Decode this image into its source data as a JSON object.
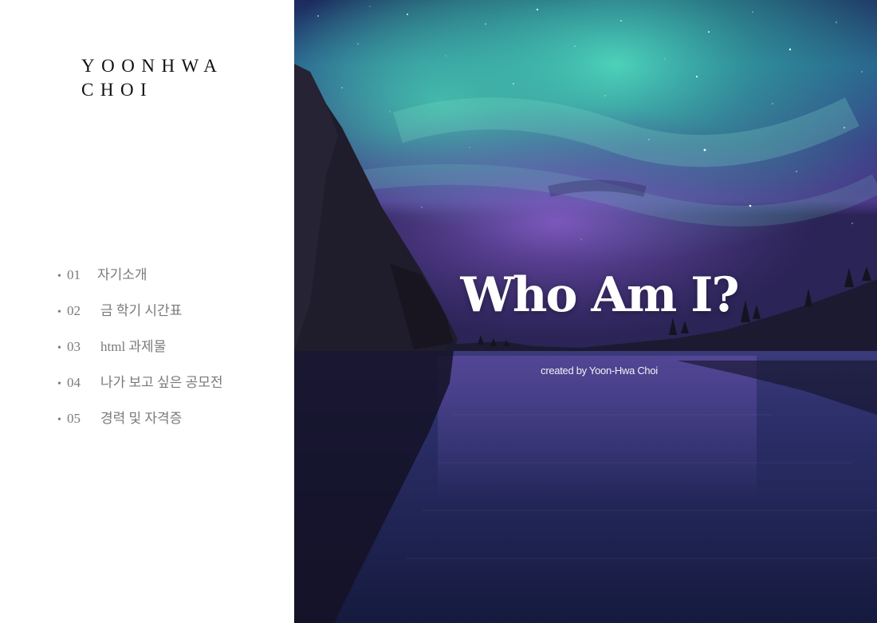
{
  "brand": {
    "line1": "YOONHWA",
    "line2": "CHOI"
  },
  "nav": {
    "items": [
      {
        "bullet": "•",
        "number": "01",
        "label": "자기소개"
      },
      {
        "bullet": "•",
        "number": "02",
        "label": "금 학기 시간표"
      },
      {
        "bullet": "•",
        "number": "03",
        "label": "html 과제물"
      },
      {
        "bullet": "•",
        "number": "04",
        "label": "나가 보고 싶은 공모전"
      },
      {
        "bullet": "•",
        "number": "05",
        "label": "경력 및 자격증"
      }
    ]
  },
  "hero": {
    "title": "Who Am I?",
    "subtitle": "created by Yoon-Hwa Choi",
    "colors": {
      "aurora": "#3fc4ae",
      "sky_purple": "#4b3a8f",
      "water": "#1c2150"
    }
  }
}
